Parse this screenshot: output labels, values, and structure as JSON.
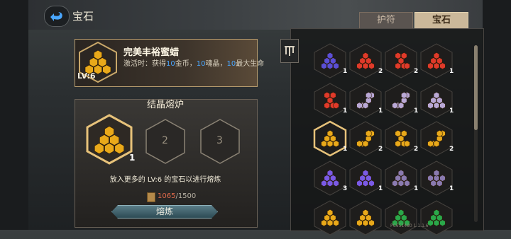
{
  "window": {
    "title": "宝石"
  },
  "tabs": [
    {
      "label": "护符",
      "active": false
    },
    {
      "label": "宝石",
      "active": true
    }
  ],
  "selected_gem": {
    "name": "完美丰裕蜜蜡",
    "level": "LV:6",
    "desc_prefix": "激活时：获得",
    "desc_n1": "10",
    "desc_t1": "金币，",
    "desc_n2": "10",
    "desc_t2": "魂晶，",
    "desc_n3": "10",
    "desc_t3": "最大生命",
    "color": "#e9a91a"
  },
  "forge": {
    "title": "结晶熔炉",
    "slots": [
      {
        "label": "1"
      },
      {
        "label": "2"
      },
      {
        "label": "3"
      }
    ],
    "hint": "放入更多的 LV:6 的宝石以进行熔炼",
    "progress_current": "1065",
    "progress_total": "/1500",
    "smelt_label": "熔炼"
  },
  "version": "PC651480 1.1.1.6",
  "inventory": [
    {
      "color": "#5a4fd6",
      "count": "1",
      "shape": "tri",
      "selected": false
    },
    {
      "color": "#e03a2a",
      "count": "2",
      "shape": "tri",
      "selected": false
    },
    {
      "color": "#e03a2a",
      "count": "2",
      "shape": "stair",
      "selected": false
    },
    {
      "color": "#e03a2a",
      "count": "1",
      "shape": "tri",
      "selected": false
    },
    {
      "color": "#e03a2a",
      "count": "1",
      "shape": "stair",
      "selected": false
    },
    {
      "color": "#b9a8d6",
      "count": "1",
      "shape": "diag",
      "selected": false
    },
    {
      "color": "#b9a8d6",
      "count": "1",
      "shape": "diag",
      "selected": false
    },
    {
      "color": "#b9a8d6",
      "count": "1",
      "shape": "tri",
      "selected": false
    },
    {
      "color": "#e9a91a",
      "count": "1",
      "shape": "tri",
      "selected": true
    },
    {
      "color": "#e9a91a",
      "count": "2",
      "shape": "diag",
      "selected": false
    },
    {
      "color": "#e9a91a",
      "count": "2",
      "shape": "stair",
      "selected": false
    },
    {
      "color": "#e9a91a",
      "count": "2",
      "shape": "diag",
      "selected": false
    },
    {
      "color": "#7a5ae6",
      "count": "3",
      "shape": "tri",
      "selected": false
    },
    {
      "color": "#7a5ae6",
      "count": "1",
      "shape": "tri",
      "selected": false
    },
    {
      "color": "#8a7ab0",
      "count": "1",
      "shape": "tri",
      "selected": false
    },
    {
      "color": "#8a7ab0",
      "count": "1",
      "shape": "row",
      "selected": false
    },
    {
      "color": "#e9a91a",
      "count": "",
      "shape": "tri",
      "selected": false
    },
    {
      "color": "#e9a91a",
      "count": "",
      "shape": "tri",
      "selected": false
    },
    {
      "color": "#2aa84a",
      "count": "",
      "shape": "tri",
      "selected": false
    },
    {
      "color": "#2aa84a",
      "count": "",
      "shape": "tri",
      "selected": false
    }
  ]
}
